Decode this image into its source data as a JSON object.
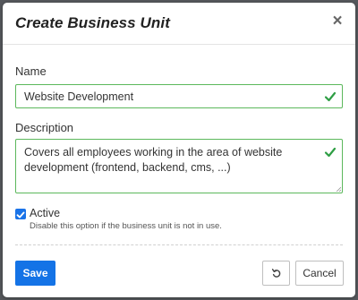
{
  "dialog": {
    "title": "Create Business Unit",
    "close_glyph": "×"
  },
  "form": {
    "name": {
      "label": "Name",
      "value": "Website Development",
      "valid": true
    },
    "description": {
      "label": "Description",
      "value": "Covers all employees working in the area of website development (frontend, backend, cms, ...)",
      "valid": true
    },
    "active": {
      "label": "Active",
      "checked": true,
      "hint": "Disable this option if the business unit is not in use."
    }
  },
  "footer": {
    "save_label": "Save",
    "reset_icon": "undo-icon",
    "cancel_label": "Cancel"
  },
  "colors": {
    "primary": "#1473e6",
    "valid": "#5cb85c",
    "checkbox": "#1a73e8"
  }
}
